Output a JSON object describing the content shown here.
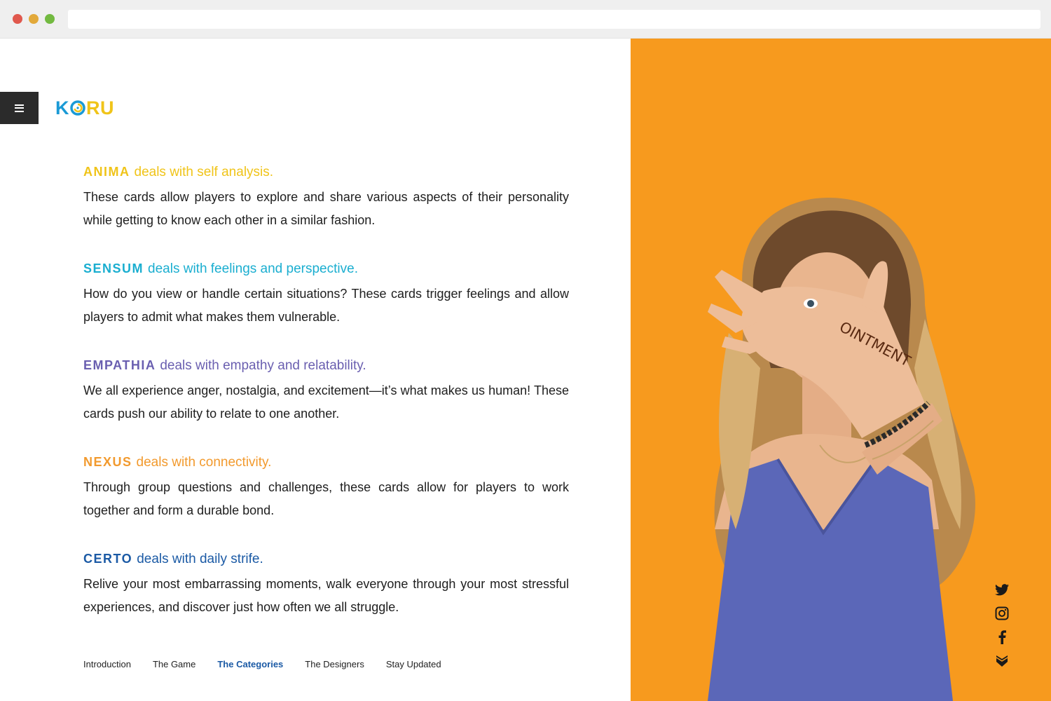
{
  "brand": {
    "logo_left": "K",
    "logo_right": "RU"
  },
  "categories": [
    {
      "name": "ANIMA",
      "desc": "deals with self analysis.",
      "color": "#f0c419",
      "body": "These cards allow players to explore and share various aspects of their personality while getting to know each other in a similar fashion."
    },
    {
      "name": "SENSUM",
      "desc": "deals with feelings and perspective.",
      "color": "#1aaed0",
      "body": "How do you view or handle certain situations? These cards trigger feelings and allow players to admit what makes them vulnerable."
    },
    {
      "name": "EMPATHIA",
      "desc": "deals with empathy and relatability.",
      "color": "#6a5fb0",
      "body": "We all experience anger, nostalgia, and excitement—it’s what makes us human! These cards push our ability to relate to one another."
    },
    {
      "name": "NEXUS",
      "desc": "deals with connectivity.",
      "color": "#f29a2e",
      "body": "Through group questions and challenges, these cards allow for players to work together and form a durable bond."
    },
    {
      "name": "CERTO",
      "desc": "deals with daily strife.",
      "color": "#1b5aa5",
      "body": "Relive your most embarrassing moments, walk everyone through your most stressful experiences, and discover just how often we all struggle."
    }
  ],
  "footer_nav": [
    "Introduction",
    "The Game",
    "The Categories",
    "The Designers",
    "Stay Updated"
  ],
  "active_nav": "The Categories",
  "hero": {
    "hand_text": "OINTMENT",
    "background": "#f79a1e"
  },
  "social_icons": [
    "twitter-icon",
    "instagram-icon",
    "facebook-icon",
    "producthunt-icon"
  ]
}
